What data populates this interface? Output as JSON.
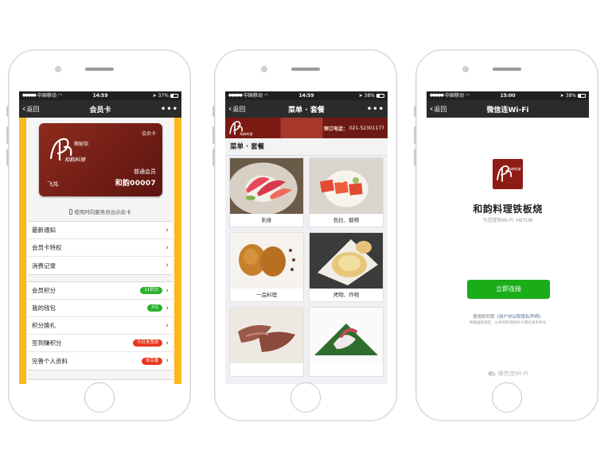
{
  "phones": [
    {
      "status": {
        "carrier": "中国移动",
        "time": "14:59",
        "battery": "37%"
      },
      "nav": {
        "back_label": "返回",
        "title": "会员卡",
        "more": "•••"
      },
      "card": {
        "type_label": "会员卡",
        "level": "普通会员",
        "number": "和韵00007",
        "holder": "飞鸿"
      },
      "show_hint": "使用时向服务员出示此卡",
      "group1": [
        {
          "label": "最新通知"
        },
        {
          "label": "会员卡特权"
        },
        {
          "label": "消费记录"
        }
      ],
      "group2": [
        {
          "label": "会员积分",
          "badge": "11积分",
          "badge_color": "#2bb12b"
        },
        {
          "label": "我的钱包",
          "badge": "0元",
          "badge_color": "#2bb12b"
        },
        {
          "label": "积分换礼",
          "badge": ""
        },
        {
          "label": "签到赚积分",
          "badge": "今日未签到",
          "badge_color": "#e8371f"
        },
        {
          "label": "完善个人资料",
          "badge": "未完善",
          "badge_color": "#e8371f"
        }
      ]
    },
    {
      "status": {
        "carrier": "中国移动",
        "time": "14:59",
        "battery": "38%"
      },
      "nav": {
        "back_label": "返回",
        "title": "菜单 · 套餐",
        "more": "•••"
      },
      "banner": {
        "phone_label": "预订电话：",
        "phone": "021-52301177"
      },
      "section_title": "菜单 · 套餐",
      "dishes": [
        {
          "caption": "刺身"
        },
        {
          "caption": "色拉、醋物"
        },
        {
          "caption": "一品料理"
        },
        {
          "caption": "烤物、炸物"
        },
        {
          "caption": ""
        },
        {
          "caption": ""
        }
      ]
    },
    {
      "status": {
        "carrier": "中国移动",
        "time": "15:00",
        "battery": "38%"
      },
      "nav": {
        "back_label": "返回",
        "title": "微信连Wi-Fi",
        "more": ""
      },
      "wifi": {
        "name": "和韵料理铁板烧",
        "ssid_line": "为您提供Wi-Fi: HEYUN",
        "connect_label": "立即连接",
        "agree_prefix": "使用即同意",
        "agree_link": "《用户协议和隐私声明》",
        "law_line": "根据国家规定，公共场所连接Wi-Fi需记录手机号",
        "footer": "微信连Wi-Fi"
      }
    }
  ],
  "colors": {
    "wechat_green": "#1aad19",
    "accent_yellow": "#fbb81c",
    "brand_red": "#8e1c14"
  }
}
